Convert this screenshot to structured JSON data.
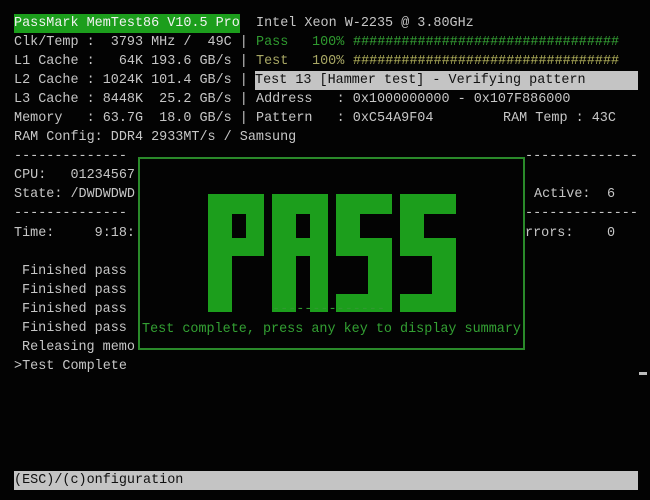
{
  "header": {
    "title": "PassMark MemTest86 V10.5 Pro",
    "cpu_name": "Intel Xeon W-2235 @ 3.80GHz"
  },
  "system": [
    {
      "label": "Clk/Temp :  3793 MHz /  49C |"
    },
    {
      "label": "L1 Cache :   64K 193.6 GB/s |"
    },
    {
      "label": "L2 Cache : 1024K 101.4 GB/s |"
    },
    {
      "label": "L3 Cache : 8448K  25.2 GB/s |"
    },
    {
      "label": "Memory   : 63.7G  18.0 GB/s |"
    },
    {
      "label": "RAM Config: DDR4 2933MT/s / Samsung"
    }
  ],
  "progress": {
    "pass_label": "Pass",
    "pass_pct": "100%",
    "pass_value": 100,
    "pass_bar": "#################################",
    "test_label": "Test",
    "test_pct": "100%",
    "test_value": 100,
    "test_bar": "#################################"
  },
  "current_test": "Test 13 [Hammer test] - Verifying pattern",
  "address": "Address   : 0x1000000000 - 0x107F886000",
  "pattern": "Pattern   : 0xC54A9F04",
  "ram_temp": "RAM Temp : 43C",
  "divider": "--------------",
  "cpu_line": "CPU:   01234567",
  "state_line": "State: /DWDWDWD",
  "time_line": "Time:     9:18:",
  "active_label": "Active:",
  "active_value": "6",
  "errors_label": "rrors:",
  "errors_value": "0",
  "log": [
    "Finished pass",
    "Finished pass",
    "Finished pass",
    "Finished pass",
    "Releasing memo",
    ">Test Complete"
  ],
  "popup": {
    "result": "PASS",
    "divider": "--------------",
    "message": "Test complete, press any key to display summary"
  },
  "footer": "(ESC)/(c)onfiguration",
  "colors": {
    "green": "#1c9e1c",
    "pass_green": "#2a8a2a",
    "bg": "#030303"
  }
}
